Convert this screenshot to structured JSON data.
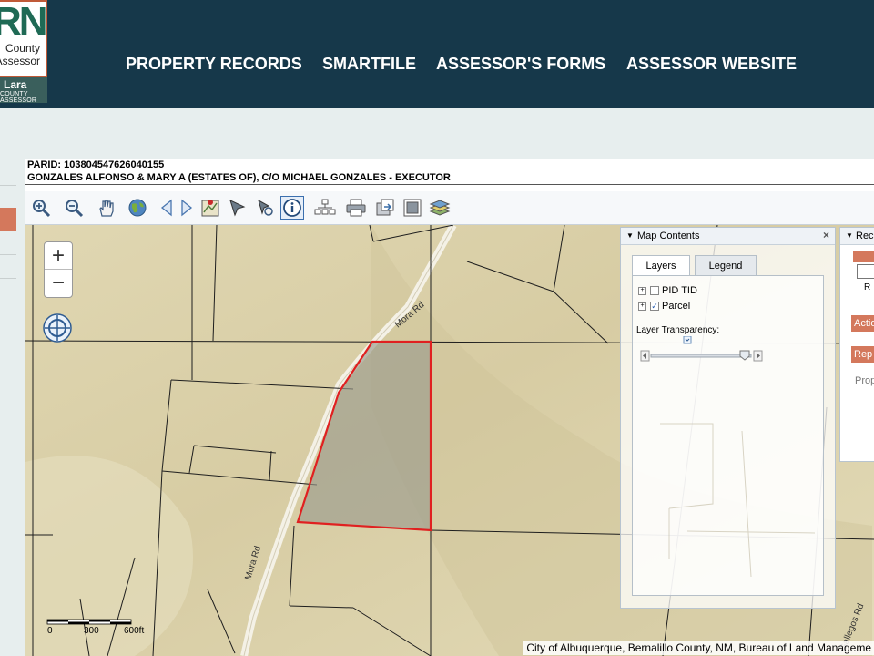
{
  "header": {
    "logo_letters": "RN",
    "logo_line1": "County",
    "logo_line2": "Assessor",
    "logo_name": "Lara",
    "logo_sub": "COUNTY ASSESSOR",
    "nav": [
      "PROPERTY RECORDS",
      "SMARTFILE",
      "ASSESSOR'S FORMS",
      "ASSESSOR WEBSITE"
    ]
  },
  "record": {
    "parid": "PARID: 103804547626040155",
    "owner": "GONZALES ALFONSO & MARY A (ESTATES OF), C/O MICHAEL GONZALES - EXECUTOR"
  },
  "toolbar": {
    "tools": [
      "zoom-in-icon",
      "zoom-out-icon",
      "pan-hand-icon",
      "globe-icon",
      "back-arrow-icon",
      "forward-arrow-icon",
      "map-identify-icon",
      "select-arrow-icon",
      "measure-icon",
      "info-icon",
      "network-icon",
      "print-icon",
      "export-icon",
      "fullscreen-icon",
      "layers-icon"
    ],
    "active_tool": "info-icon"
  },
  "map": {
    "zoom_in": "+",
    "zoom_out": "−",
    "road_labels": [
      "Mora Rd",
      "Mora Rd",
      "Gallegos Rd"
    ],
    "scale_labels": [
      "0",
      "300",
      "600ft"
    ],
    "attribution": "City of Albuquerque, Bernalillo County, NM, Bureau of Land Manageme",
    "parcel_color": "#e02020"
  },
  "map_contents": {
    "title": "Map Contents",
    "close": "×",
    "tabs": [
      "Layers",
      "Legend"
    ],
    "layers": [
      {
        "name": "PID TID",
        "checked": false
      },
      {
        "name": "Parcel",
        "checked": true
      }
    ],
    "transparency_label": "Layer Transparency:"
  },
  "record_card": {
    "title": "Reco",
    "r_label": "R",
    "action_label": "Actio",
    "report_label": "Rep",
    "prop_label": "Prop"
  },
  "colors": {
    "header": "#16384a",
    "accent": "#d4785c",
    "parcel_outline": "#e02020"
  }
}
